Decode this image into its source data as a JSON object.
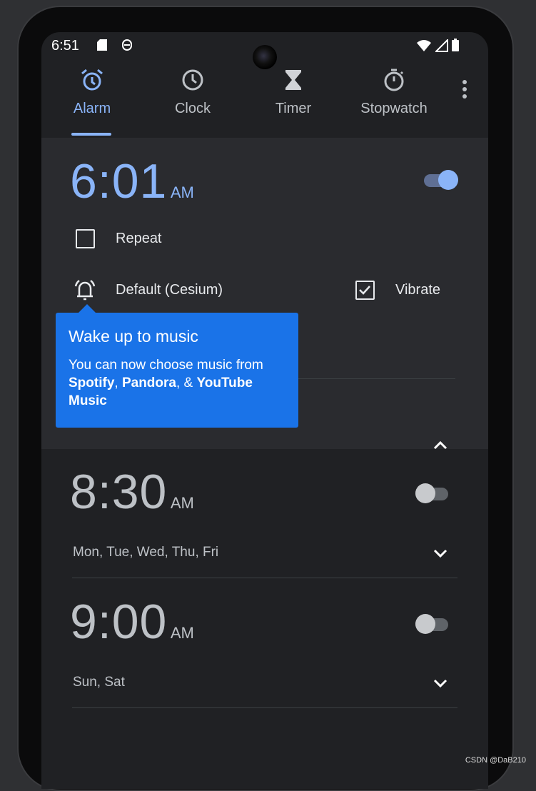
{
  "status_bar": {
    "time": "6:51",
    "icons": [
      "sd-card-icon",
      "sync-icon",
      "wifi-icon",
      "signal-icon",
      "battery-icon"
    ]
  },
  "tabs": [
    {
      "label": "Alarm",
      "icon": "alarm-icon",
      "active": true
    },
    {
      "label": "Clock",
      "icon": "clock-icon"
    },
    {
      "label": "Timer",
      "icon": "hourglass-icon"
    },
    {
      "label": "Stopwatch",
      "icon": "stopwatch-icon"
    }
  ],
  "accent": "#8ab4f8",
  "alarms": [
    {
      "time": "6:01",
      "ampm": "AM",
      "enabled": true,
      "expanded": true,
      "repeat_label": "Repeat",
      "repeat": false,
      "ringtone": "Default (Cesium)",
      "vibrate_label": "Vibrate",
      "vibrate": true
    },
    {
      "time": "8:30",
      "ampm": "AM",
      "enabled": false,
      "days": "Mon, Tue, Wed, Thu, Fri"
    },
    {
      "time": "9:00",
      "ampm": "AM",
      "enabled": false,
      "days": "Sun, Sat"
    }
  ],
  "tooltip": {
    "title": "Wake up to music",
    "body_start": "You can now choose music from ",
    "spotify": "Spotify",
    "sep1": ", ",
    "pandora": "Pandora",
    "sep2": ", & ",
    "youtube": "YouTube Music",
    "color": "#1a73e8"
  },
  "watermark": "CSDN @DaB210"
}
